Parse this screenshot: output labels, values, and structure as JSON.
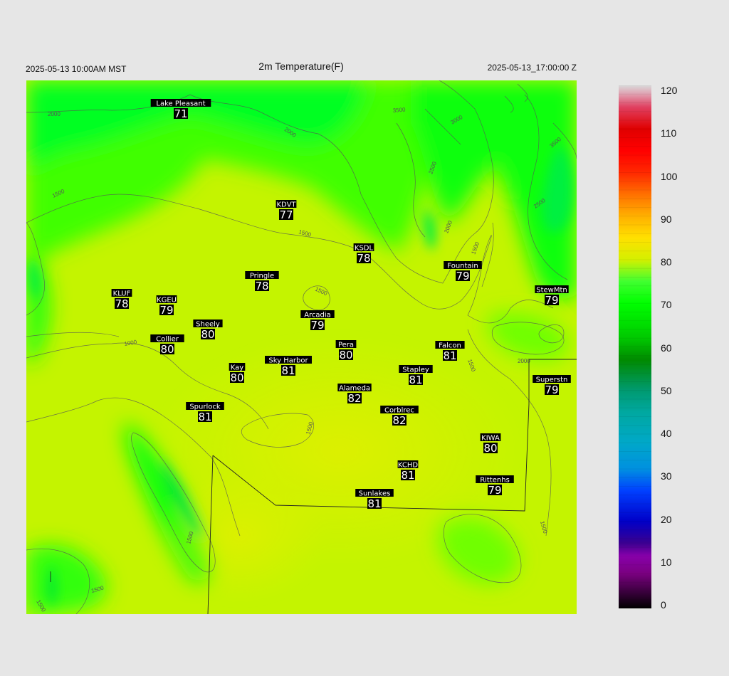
{
  "header": {
    "left": "2025-05-13 10:00AM MST",
    "title": "2m Temperature(F)",
    "right": "2025-05-13_17:00:00 Z"
  },
  "colorbar": {
    "min": 0,
    "max": 120,
    "ticks": [
      "0",
      "10",
      "20",
      "30",
      "40",
      "50",
      "60",
      "70",
      "80",
      "90",
      "100",
      "110",
      "120"
    ],
    "stops": [
      {
        "value": 0,
        "color": "#000000"
      },
      {
        "value": 8,
        "color": "#7a0080"
      },
      {
        "value": 12,
        "color": "#8800aa"
      },
      {
        "value": 15,
        "color": "#3a0090"
      },
      {
        "value": 20,
        "color": "#0000c8"
      },
      {
        "value": 27,
        "color": "#0040ff"
      },
      {
        "value": 32,
        "color": "#0090e0"
      },
      {
        "value": 38,
        "color": "#00a8c8"
      },
      {
        "value": 45,
        "color": "#00a8a0"
      },
      {
        "value": 50,
        "color": "#009a70"
      },
      {
        "value": 57,
        "color": "#008a00"
      },
      {
        "value": 62,
        "color": "#00c800"
      },
      {
        "value": 70,
        "color": "#00ff00"
      },
      {
        "value": 75,
        "color": "#40ff30"
      },
      {
        "value": 80,
        "color": "#d4f000"
      },
      {
        "value": 85,
        "color": "#ffe000"
      },
      {
        "value": 90,
        "color": "#ffb000"
      },
      {
        "value": 95,
        "color": "#ff7000"
      },
      {
        "value": 100,
        "color": "#ff2800"
      },
      {
        "value": 105,
        "color": "#ff0000"
      },
      {
        "value": 110,
        "color": "#e00000"
      },
      {
        "value": 115,
        "color": "#e04060"
      },
      {
        "value": 118,
        "color": "#e0a0b0"
      },
      {
        "value": 120,
        "color": "#d8d8d8"
      }
    ]
  },
  "contour_labels": [
    "2000",
    "1500",
    "1000",
    "3500",
    "3000",
    "2500"
  ],
  "stations": [
    {
      "name": "Lake Pleasant",
      "value": "71"
    },
    {
      "name": "KDVT",
      "value": "77"
    },
    {
      "name": "KSDL",
      "value": "78"
    },
    {
      "name": "Pringle",
      "value": "78"
    },
    {
      "name": "Fountain",
      "value": "79"
    },
    {
      "name": "StewMtn",
      "value": "79"
    },
    {
      "name": "KLUF",
      "value": "78"
    },
    {
      "name": "KGEU",
      "value": "79"
    },
    {
      "name": "Arcadia",
      "value": "79"
    },
    {
      "name": "Sheely",
      "value": "80"
    },
    {
      "name": "Collier",
      "value": "80"
    },
    {
      "name": "Pera",
      "value": "80"
    },
    {
      "name": "Falcon",
      "value": "81"
    },
    {
      "name": "Sky Harbor",
      "value": "81"
    },
    {
      "name": "Kay",
      "value": "80"
    },
    {
      "name": "Stapley",
      "value": "81"
    },
    {
      "name": "Superstn",
      "value": "79"
    },
    {
      "name": "Alameda",
      "value": "82"
    },
    {
      "name": "Spurlock",
      "value": "81"
    },
    {
      "name": "Corblrec",
      "value": "82"
    },
    {
      "name": "KIWA",
      "value": "80"
    },
    {
      "name": "KCHD",
      "value": "81"
    },
    {
      "name": "Rittenhs",
      "value": "79"
    },
    {
      "name": "Sunlakes",
      "value": "81"
    }
  ]
}
